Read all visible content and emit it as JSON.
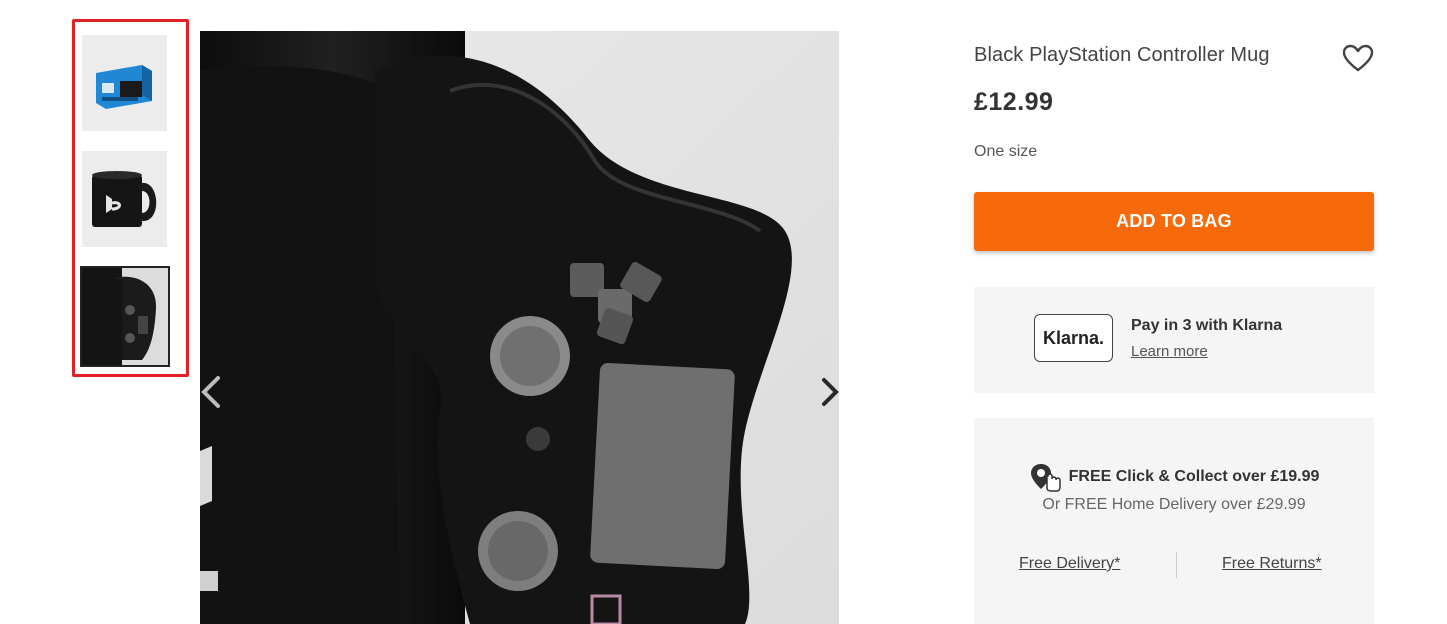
{
  "product": {
    "title": "Black PlayStation Controller Mug",
    "price": "£12.99",
    "size": "One size",
    "add_to_bag_label": "ADD TO BAG"
  },
  "klarna": {
    "logo_text": "Klarna.",
    "title": "Pay in 3 with Klarna",
    "link": "Learn more"
  },
  "delivery": {
    "collect_text": "FREE Click & Collect over £19.99",
    "home_text": "Or FREE Home Delivery over £29.99",
    "free_delivery_link": "Free Delivery*",
    "free_returns_link": "Free Returns*"
  },
  "gallery": {
    "thumbnails": [
      "boxed-mug-thumbnail",
      "mug-front-thumbnail",
      "mug-handle-thumbnail"
    ],
    "selected_index": 2,
    "highlight_color": "#e32124"
  },
  "colors": {
    "accent": "#f76a0c",
    "panel": "#f5f5f5"
  },
  "icons": {
    "wishlist": "heart-icon",
    "prev": "chevron-left-icon",
    "next": "chevron-right-icon",
    "collect": "click-collect-icon"
  }
}
